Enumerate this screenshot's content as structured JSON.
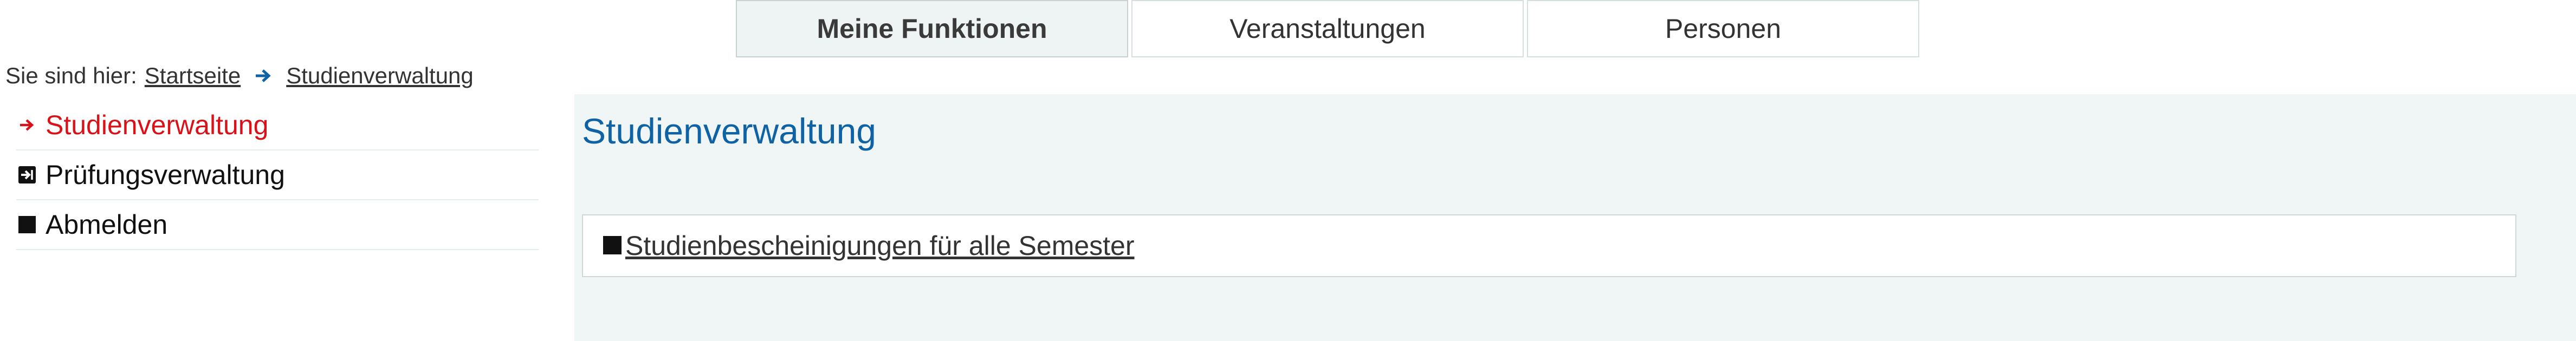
{
  "tabs": [
    {
      "label": "Meine Funktionen",
      "active": true
    },
    {
      "label": "Veranstaltungen",
      "active": false
    },
    {
      "label": "Personen",
      "active": false
    }
  ],
  "breadcrumb": {
    "prefix": "Sie sind hier:",
    "items": [
      "Startseite",
      "Studienverwaltung"
    ],
    "separator_icon": "arrow-right-icon"
  },
  "sidebar": {
    "items": [
      {
        "label": "Studienverwaltung",
        "icon": "arrow-right-icon",
        "active": true
      },
      {
        "label": "Prüfungsverwaltung",
        "icon": "enter-box-icon",
        "active": false
      },
      {
        "label": "Abmelden",
        "icon": "square-bullet-icon",
        "active": false
      }
    ]
  },
  "main": {
    "title": "Studienverwaltung",
    "links": [
      {
        "label": "Studienbescheinigungen für alle Semester",
        "icon": "square-bullet-icon"
      }
    ]
  },
  "colors": {
    "accent_blue": "#0f63a4",
    "active_red": "#d9121a",
    "content_bg": "#f0f6f5",
    "tab_active_bg": "#eef3f3"
  }
}
